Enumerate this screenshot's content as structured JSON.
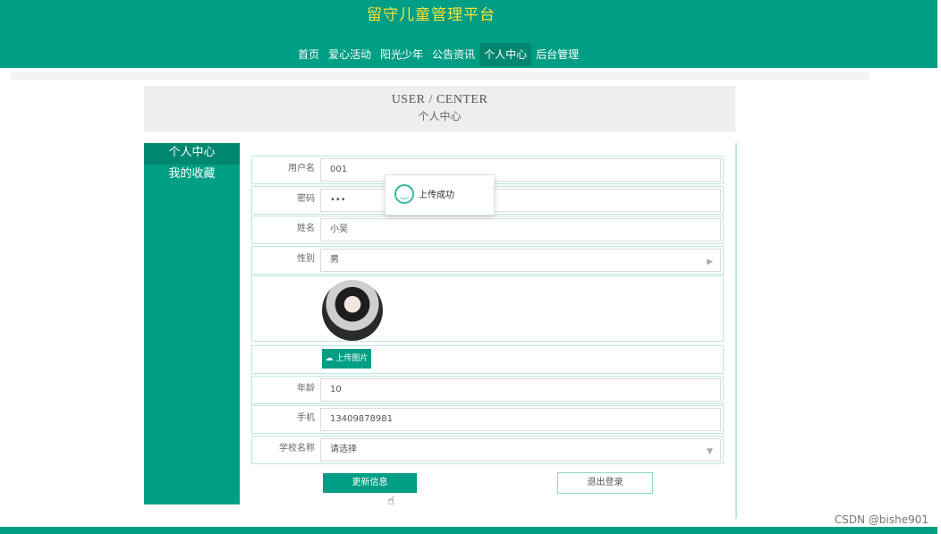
{
  "site": {
    "title": "留守儿童管理平台"
  },
  "nav": {
    "items": [
      {
        "label": "首页"
      },
      {
        "label": "爱心活动"
      },
      {
        "label": "阳光少年"
      },
      {
        "label": "公告资讯"
      },
      {
        "label": "个人中心"
      },
      {
        "label": "后台管理"
      }
    ]
  },
  "banner": {
    "en": "USER / CENTER",
    "zh": "个人中心"
  },
  "sidebar": {
    "items": [
      {
        "label": "个人中心"
      },
      {
        "label": "我的收藏"
      }
    ]
  },
  "form": {
    "username_label": "用户名",
    "username_value": "001",
    "password_label": "密码",
    "password_value": "•••",
    "name_label": "姓名",
    "name_value": "小吴",
    "gender_label": "性别",
    "gender_value": "男",
    "upload_label": "上传图片",
    "age_label": "年龄",
    "age_value": "10",
    "phone_label": "手机",
    "phone_value": "13409878981",
    "school_label": "学校名称",
    "school_value": "请选择"
  },
  "toast": {
    "message": "上传成功"
  },
  "buttons": {
    "update": "更新信息",
    "logout": "退出登录"
  },
  "watermark": "CSDN @bishe901",
  "colors": {
    "primary": "#009e84",
    "title": "#f5e23c"
  }
}
